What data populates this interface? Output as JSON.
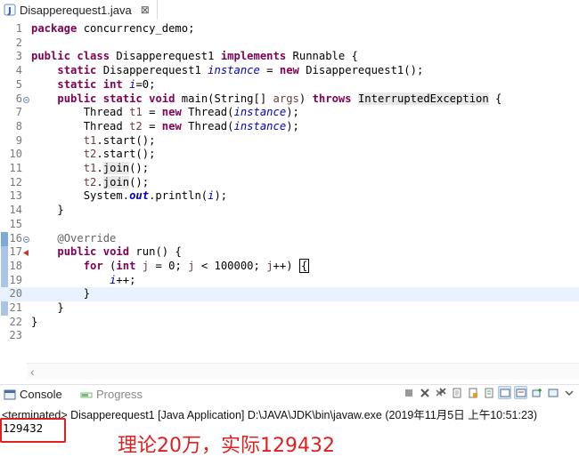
{
  "editor_tab": {
    "title": "Disapperequest1.java",
    "close_label": "⊠"
  },
  "code": {
    "lines": [
      {
        "n": "1",
        "html": "<span class=\"kw\">package</span> concurrency_demo;"
      },
      {
        "n": "2",
        "html": ""
      },
      {
        "n": "3",
        "html": "<span class=\"kw\">public</span> <span class=\"kw\">class</span> Disapperequest1 <span class=\"kw\">implements</span> Runnable {"
      },
      {
        "n": "4",
        "html": "    <span class=\"kw\">static</span> Disapperequest1 <span class=\"fld\">instance</span> = <span class=\"kw\">new</span> Disapperequest1();"
      },
      {
        "n": "5",
        "html": "    <span class=\"kw\">static</span> <span class=\"kw\">int</span> <span class=\"fld\">i</span>=0;"
      },
      {
        "n": "6",
        "html": "    <span class=\"kw\">public</span> <span class=\"kw\">static</span> <span class=\"kw\">void</span> main(String[] <span style=\"color:#6a3e3e\">args</span>) <span class=\"kw\">throws</span> <span class=\"hl-bg\">InterruptedException</span> {"
      },
      {
        "n": "7",
        "html": "        Thread <span style=\"color:#6a3e3e\">t1</span> = <span class=\"kw\">new</span> Thread(<span class=\"fld\">instance</span>);"
      },
      {
        "n": "8",
        "html": "        Thread <span style=\"color:#6a3e3e\">t2</span> = <span class=\"kw\">new</span> Thread(<span class=\"fld\">instance</span>);"
      },
      {
        "n": "9",
        "html": "        <span style=\"color:#6a3e3e\">t1</span>.start();"
      },
      {
        "n": "10",
        "html": "        <span style=\"color:#6a3e3e\">t2</span>.start();"
      },
      {
        "n": "11",
        "html": "        <span style=\"color:#6a3e3e\">t1</span>.<span class=\"hl-bg\">join</span>();"
      },
      {
        "n": "12",
        "html": "        <span style=\"color:#6a3e3e\">t2</span>.<span class=\"hl-bg\">join</span>();"
      },
      {
        "n": "13",
        "html": "        System.<span class=\"fld\" style=\"font-weight:bold\">out</span>.println(<span class=\"fld\">i</span>);"
      },
      {
        "n": "14",
        "html": "    }"
      },
      {
        "n": "15",
        "html": ""
      },
      {
        "n": "16",
        "html": "    <span class=\"ann\">@Override</span>"
      },
      {
        "n": "17",
        "html": "    <span class=\"kw\">public</span> <span class=\"kw\">void</span> run() {"
      },
      {
        "n": "18",
        "html": "        <span class=\"kw\">for</span> (<span class=\"kw\">int</span> <span style=\"color:#6a3e3e\">j</span> = 0; <span style=\"color:#6a3e3e\">j</span> &lt; 100000; <span style=\"color:#6a3e3e\">j</span>++) <span class=\"outbox\">{</span>"
      },
      {
        "n": "19",
        "html": "            <span class=\"fld\">i</span>++;"
      },
      {
        "n": "20",
        "html": "        }"
      },
      {
        "n": "21",
        "html": "    }"
      },
      {
        "n": "22",
        "html": "}"
      },
      {
        "n": "23",
        "html": ""
      }
    ]
  },
  "console": {
    "tab_console": "Console",
    "tab_progress": "Progress",
    "status_line": "<terminated> Disapperequest1 [Java Application] D:\\JAVA\\JDK\\bin\\javaw.exe (2019年11月5日 上午10:51:23)",
    "output": "129432"
  },
  "annotation": {
    "text": "理论20万，实际129432"
  },
  "colors": {
    "annotation_red": "#e02020",
    "keyword": "#7f0055",
    "field": "#0000c0"
  },
  "icons": [
    "java-file-icon",
    "console-icon",
    "progress-icon",
    "terminate-icon",
    "remove-launch-icon",
    "remove-all-icon",
    "scroll-lock-icon",
    "word-wrap-icon",
    "pin-icon",
    "display-console-icon",
    "new-console-icon",
    "view-menu-icon"
  ]
}
